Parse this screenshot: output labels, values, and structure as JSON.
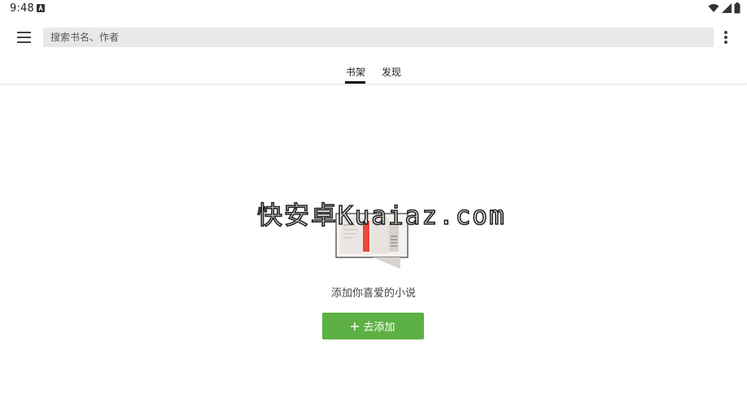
{
  "status_bar": {
    "time": "9:48",
    "notification_icon": "a-badge-icon",
    "icons": [
      "wifi-icon",
      "signal-icon",
      "battery-icon"
    ]
  },
  "toolbar": {
    "menu_icon": "hamburger-menu-icon",
    "search": {
      "placeholder": "搜索书名、作者",
      "value": ""
    },
    "more_icon": "more-vert-icon"
  },
  "tabs": [
    {
      "label": "书架",
      "selected": true
    },
    {
      "label": "发现",
      "selected": false
    }
  ],
  "empty_state": {
    "illustration_icon": "bookshelf-illustration-icon",
    "message": "添加你喜爱的小说",
    "button_label": "去添加",
    "button_icon": "plus-icon"
  },
  "watermark": "快安卓Kuaiaz.com",
  "colors": {
    "accent": "#5db043",
    "search_bg": "#e8e8e8",
    "tab_indicator": "#111111",
    "bookmark": "#e84a3a"
  }
}
